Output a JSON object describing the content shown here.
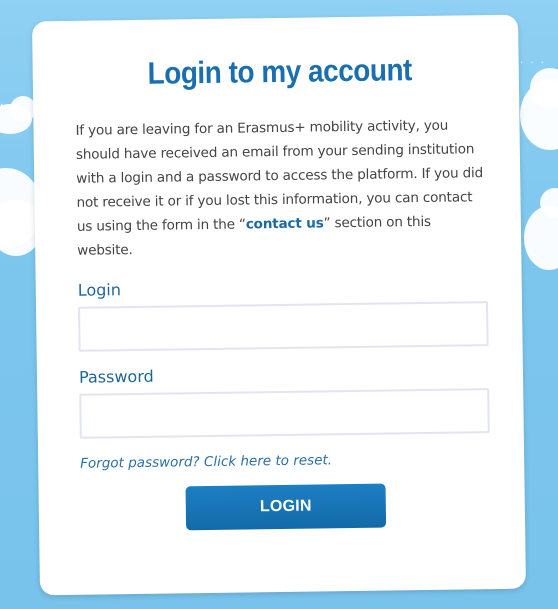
{
  "title": "Login to my account",
  "description": {
    "text_before": "If you are leaving for an Erasmus+ mobility activity, you should have received an email from your sending institution with a login and a password to access the platform. If you did not receive it or if you lost this information, you can contact us using the form in the “",
    "link": "contact us",
    "text_after": "” section on this website."
  },
  "form": {
    "login_label": "Login",
    "login_value": "",
    "password_label": "Password",
    "password_value": "",
    "forgot_link": "Forgot password? Click here to reset.",
    "submit_label": "LOGIN"
  },
  "colors": {
    "background": "#7cc6ee",
    "title": "#1a6fb0",
    "button": "#1672b5"
  },
  "icons": [
    "cloud-left",
    "cloud-right",
    "cloud-right-lower"
  ]
}
